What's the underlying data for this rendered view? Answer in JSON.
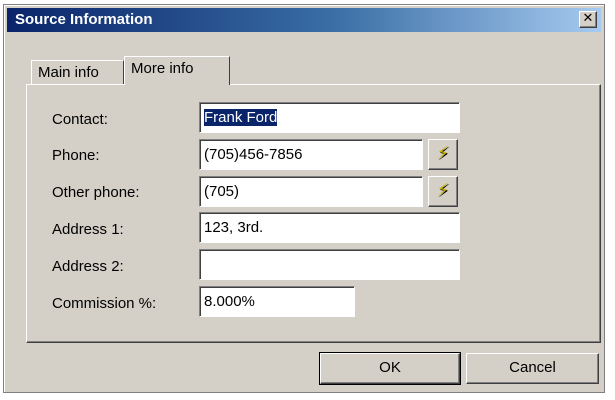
{
  "window": {
    "title": "Source Information",
    "close_symbol": "✕"
  },
  "tabs": [
    {
      "label": "Main info",
      "active": false
    },
    {
      "label": "More info",
      "active": true
    }
  ],
  "form": {
    "contact": {
      "label": "Contact:",
      "value": "Frank Ford",
      "selected": true
    },
    "phone": {
      "label": "Phone:",
      "value": "(705)456-7856",
      "action_icon": "lightning-icon"
    },
    "other_phone": {
      "label": "Other phone:",
      "value": "(705)",
      "action_icon": "lightning-icon"
    },
    "address1": {
      "label": "Address 1:",
      "value": "123, 3rd."
    },
    "address2": {
      "label": "Address 2:",
      "value": ""
    },
    "commission": {
      "label": "Commission %:",
      "value": "8.000%"
    }
  },
  "buttons": {
    "ok": "OK",
    "cancel": "Cancel"
  },
  "icons": {
    "bolt_glyph": "⚡"
  },
  "colors": {
    "titlebar_start": "#0a246a",
    "titlebar_end": "#a6caf0",
    "face": "#d4d0c8",
    "selection": "#0a246a"
  }
}
